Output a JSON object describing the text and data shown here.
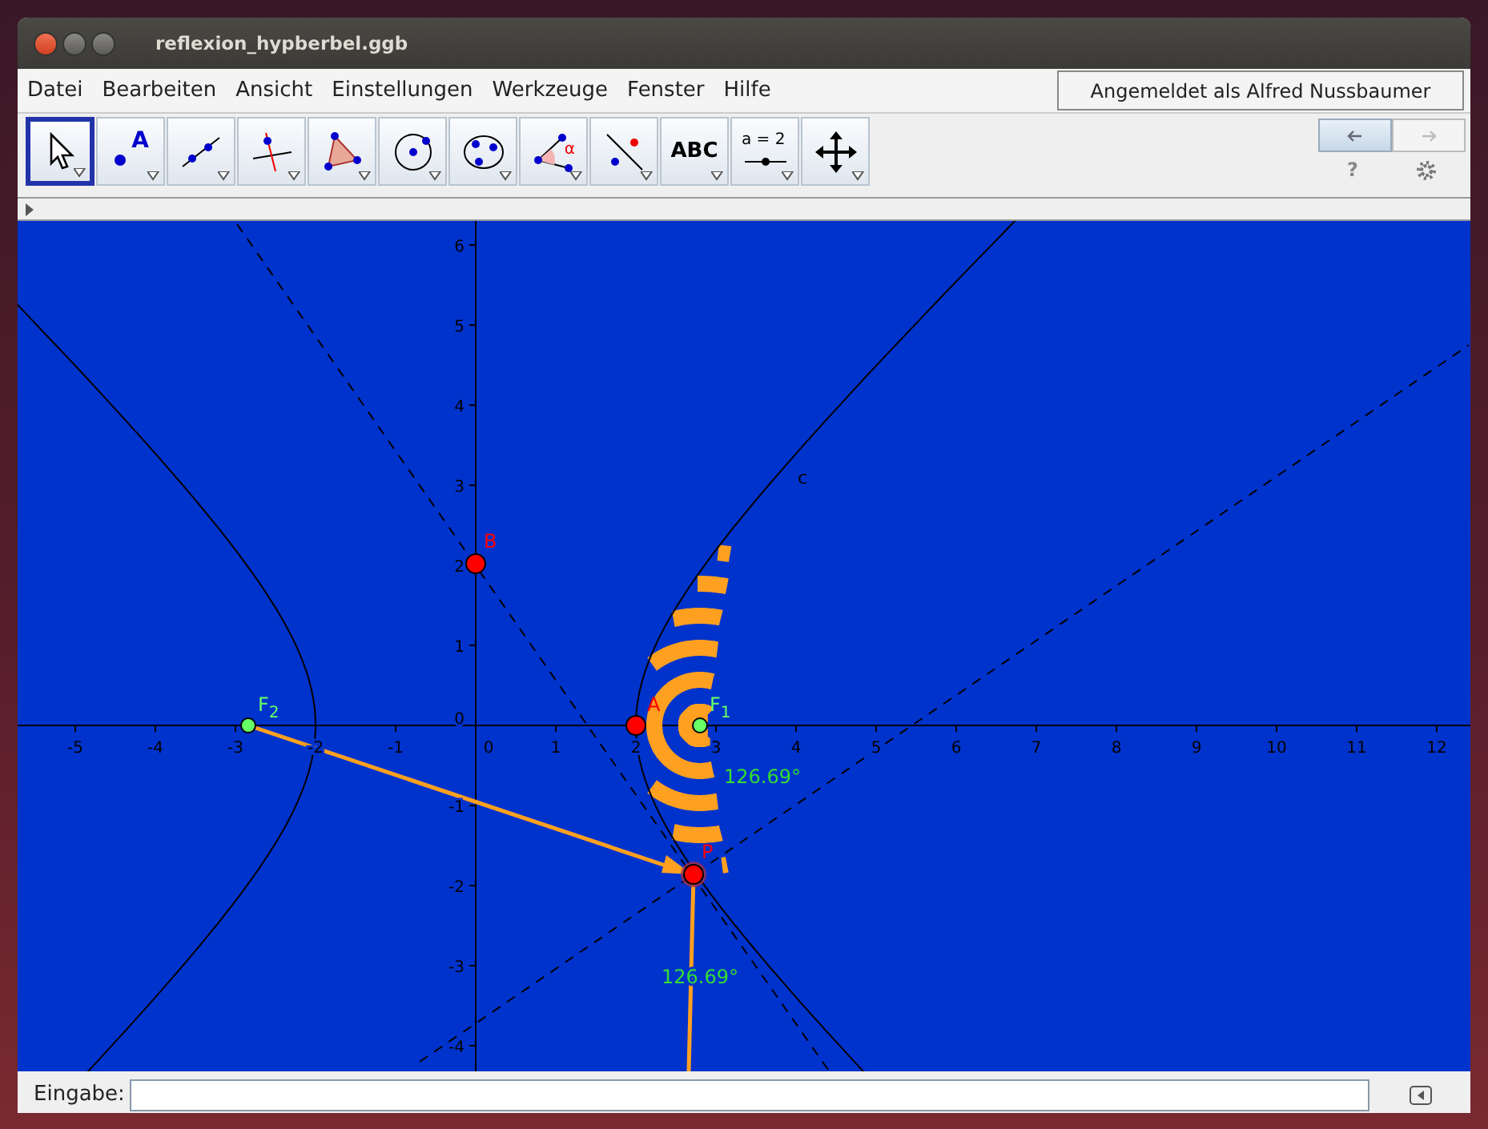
{
  "window": {
    "title": "reflexion_hypberbel.ggb"
  },
  "menu": [
    "Datei",
    "Bearbeiten",
    "Ansicht",
    "Einstellungen",
    "Werkzeuge",
    "Fenster",
    "Hilfe"
  ],
  "login_button": "Angemeldet als Alfred Nussbaumer",
  "toolbar": {
    "tools": [
      {
        "kind": "move",
        "selected": true
      },
      {
        "kind": "point",
        "glyph": "A",
        "selected": false
      },
      {
        "kind": "line",
        "selected": false
      },
      {
        "kind": "perpendicular",
        "selected": false
      },
      {
        "kind": "polygon",
        "selected": false
      },
      {
        "kind": "circle",
        "selected": false
      },
      {
        "kind": "conic",
        "selected": false
      },
      {
        "kind": "angle",
        "glyph": "α",
        "selected": false
      },
      {
        "kind": "reflect",
        "selected": false
      },
      {
        "kind": "text",
        "glyph": "ABC",
        "selected": false
      },
      {
        "kind": "slider",
        "glyph": "a = 2",
        "selected": false
      },
      {
        "kind": "pan",
        "selected": false
      }
    ],
    "undo": {
      "disabled": false
    },
    "redo": {
      "disabled": true
    },
    "help": "?"
  },
  "graphics": {
    "x_tick_labels": [
      "-5",
      "-4",
      "-3",
      "-2",
      "-1",
      "0",
      "1",
      "2",
      "3",
      "4",
      "5",
      "6",
      "7",
      "8",
      "9",
      "10",
      "11",
      "12"
    ],
    "y_tick_labels": [
      "6",
      "5",
      "4",
      "3",
      "2",
      "1",
      "0",
      "-1",
      "-2",
      "-3",
      "-4"
    ],
    "curve_label": "c",
    "points": [
      {
        "label": "B",
        "color": "#ff0000"
      },
      {
        "label": "F$_{2}$",
        "color": "#66ff66"
      },
      {
        "label": "A",
        "color": "#ff0000"
      },
      {
        "label": "F$_{1}$",
        "color": "#66ff66"
      },
      {
        "label": "P",
        "color": "#ff0000"
      }
    ],
    "angle_labels": [
      "126.69°",
      "126.69°"
    ]
  },
  "input_bar": {
    "label": "Eingabe:"
  }
}
